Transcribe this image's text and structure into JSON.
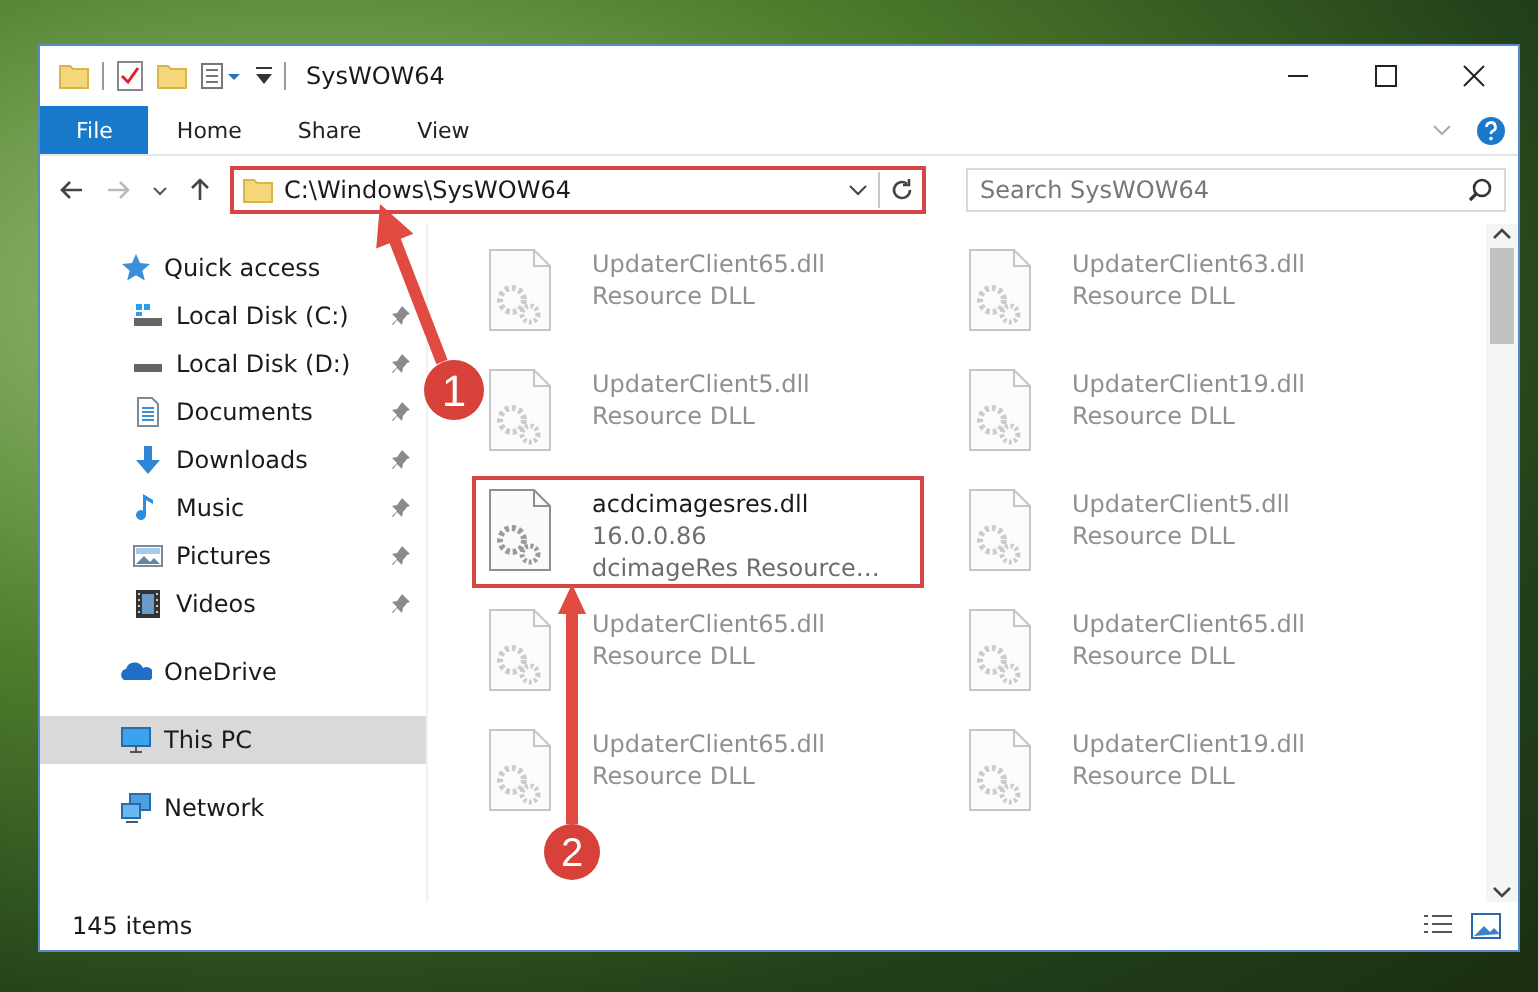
{
  "window": {
    "title": "SysWOW64"
  },
  "ribbon_tabs": [
    {
      "label": "File",
      "selected": true
    },
    {
      "label": "Home",
      "selected": false
    },
    {
      "label": "Share",
      "selected": false
    },
    {
      "label": "View",
      "selected": false
    }
  ],
  "address": {
    "path": "C:\\Windows\\SysWOW64",
    "highlighted": true
  },
  "search": {
    "placeholder": "Search SysWOW64"
  },
  "sidebar": {
    "items": [
      {
        "label": "Quick access",
        "kind": "star",
        "selected": false,
        "children": [
          {
            "label": "Local Disk (C:)",
            "kind": "windrive",
            "pinned": true,
            "selected": false
          },
          {
            "label": "Local Disk (D:)",
            "kind": "drive",
            "pinned": true,
            "selected": false
          },
          {
            "label": "Documents",
            "kind": "documents",
            "pinned": true,
            "selected": false
          },
          {
            "label": "Downloads",
            "kind": "downloads",
            "pinned": true,
            "selected": false
          },
          {
            "label": "Music",
            "kind": "music",
            "pinned": true,
            "selected": false
          },
          {
            "label": "Pictures",
            "kind": "pictures",
            "pinned": true,
            "selected": false
          },
          {
            "label": "Videos",
            "kind": "videos",
            "pinned": true,
            "selected": false
          }
        ]
      },
      {
        "label": "OneDrive",
        "kind": "cloud",
        "selected": false
      },
      {
        "label": "This PC",
        "kind": "pc",
        "selected": true
      },
      {
        "label": "Network",
        "kind": "network",
        "selected": false
      }
    ]
  },
  "files": [
    {
      "name": "UpdaterClient65.dll",
      "details": [
        "Resource DLL"
      ],
      "blurred": true,
      "highlighted": false
    },
    {
      "name": "UpdaterClient63.dll",
      "details": [
        "Resource DLL"
      ],
      "blurred": true,
      "highlighted": false
    },
    {
      "name": "UpdaterClient5.dll",
      "details": [
        "Resource DLL"
      ],
      "blurred": true,
      "highlighted": false
    },
    {
      "name": "UpdaterClient19.dll",
      "details": [
        "Resource DLL"
      ],
      "blurred": true,
      "highlighted": false
    },
    {
      "name": "acdcimagesres.dll",
      "details": [
        "16.0.0.86",
        "dcimageRes Resource…"
      ],
      "blurred": false,
      "highlighted": true
    },
    {
      "name": "UpdaterClient5.dll",
      "details": [
        "Resource DLL"
      ],
      "blurred": true,
      "highlighted": false
    },
    {
      "name": "UpdaterClient65.dll",
      "details": [
        "Resource DLL"
      ],
      "blurred": true,
      "highlighted": false
    },
    {
      "name": "UpdaterClient65.dll",
      "details": [
        "Resource DLL"
      ],
      "blurred": true,
      "highlighted": false
    },
    {
      "name": "UpdaterClient65.dll",
      "details": [
        "Resource DLL"
      ],
      "blurred": true,
      "highlighted": false
    },
    {
      "name": "UpdaterClient19.dll",
      "details": [
        "Resource DLL"
      ],
      "blurred": true,
      "highlighted": false
    }
  ],
  "status_bar": {
    "text": "145 items"
  },
  "annotations": [
    {
      "number": "1"
    },
    {
      "number": "2"
    }
  ]
}
